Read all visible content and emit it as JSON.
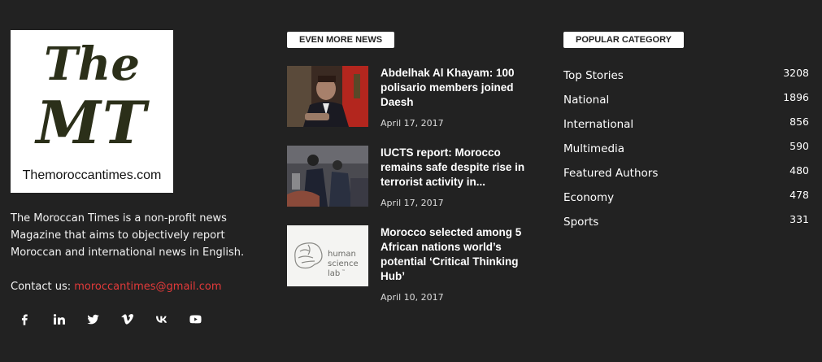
{
  "logo": {
    "line1": "The",
    "line2": "MT",
    "url_text": "Themoroccantimes.com"
  },
  "about": {
    "text": "The Moroccan Times is a non-profit news Magazine that aims to objectively report Moroccan and international news in English.",
    "contact_label": "Contact us: ",
    "email": "moroccantimes@gmail.com"
  },
  "socials": [
    "facebook-icon",
    "linkedin-icon",
    "twitter-icon",
    "vimeo-icon",
    "vk-icon",
    "youtube-icon"
  ],
  "news": {
    "heading": "EVEN MORE NEWS",
    "items": [
      {
        "title": "Abdelhak Al Khayam: 100 polisario members joined Daesh",
        "date": "April 17, 2017"
      },
      {
        "title": "IUCTS report: Morocco remains safe despite rise in terrorist activity in...",
        "date": "April 17, 2017"
      },
      {
        "title": "Morocco selected among 5 African nations world’s potential ‘Critical Thinking Hub’",
        "date": "April 10, 2017"
      }
    ],
    "thumb3_text": {
      "l1": "human",
      "l2": "science",
      "l3": "lab",
      "tm": "™"
    }
  },
  "categories": {
    "heading": "POPULAR CATEGORY",
    "items": [
      {
        "name": "Top Stories",
        "count": "3208"
      },
      {
        "name": "National",
        "count": "1896"
      },
      {
        "name": "International",
        "count": "856"
      },
      {
        "name": "Multimedia",
        "count": "590"
      },
      {
        "name": "Featured Authors",
        "count": "480"
      },
      {
        "name": "Economy",
        "count": "478"
      },
      {
        "name": "Sports",
        "count": "331"
      }
    ]
  },
  "colors": {
    "background": "#222222",
    "link_red": "#e23a3a",
    "tag_bg": "#ffffff"
  }
}
